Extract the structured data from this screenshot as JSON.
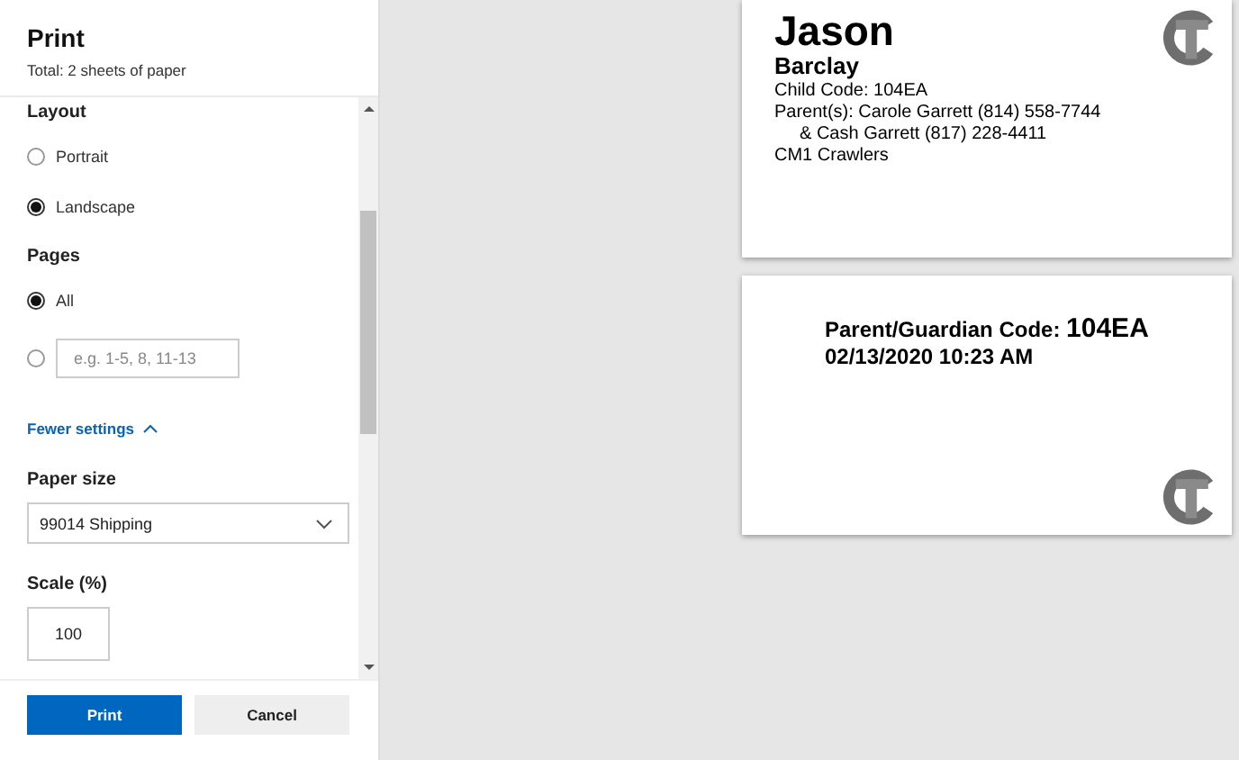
{
  "dialog": {
    "title": "Print",
    "subtitle": "Total: 2 sheets of paper"
  },
  "layout": {
    "label": "Layout",
    "options": [
      {
        "label": "Portrait",
        "selected": false
      },
      {
        "label": "Landscape",
        "selected": true
      }
    ]
  },
  "pages": {
    "label": "Pages",
    "options": [
      {
        "kind": "radio",
        "label": "All",
        "selected": true
      },
      {
        "kind": "range",
        "placeholder": "e.g. 1-5, 8, 11-13",
        "selected": false
      }
    ]
  },
  "toggle": {
    "label": "Fewer settings",
    "expanded": true
  },
  "paper_size": {
    "label": "Paper size",
    "value": "99014 Shipping"
  },
  "scale": {
    "label": "Scale (%)",
    "value": "100"
  },
  "buttons": [
    {
      "label": "Print",
      "kind": "primary"
    },
    {
      "label": "Cancel",
      "kind": "secondary"
    }
  ],
  "preview": [
    {
      "kind": "name_label",
      "first_name": "Jason",
      "last_name": "Barclay",
      "lines": [
        {
          "text": "Child Code: 104EA",
          "indented": false
        },
        {
          "text": "Parent(s): Carole Garrett (814) 558-7744",
          "indented": false
        },
        {
          "text": "& Cash Garrett (817) 228-4411",
          "indented": true
        },
        {
          "text": "CM1 Crawlers",
          "indented": false
        }
      ]
    },
    {
      "kind": "code_label",
      "code_label": "Parent/Guardian Code:",
      "code": "104EA",
      "timestamp": "02/13/2020 10:23 AM"
    }
  ]
}
